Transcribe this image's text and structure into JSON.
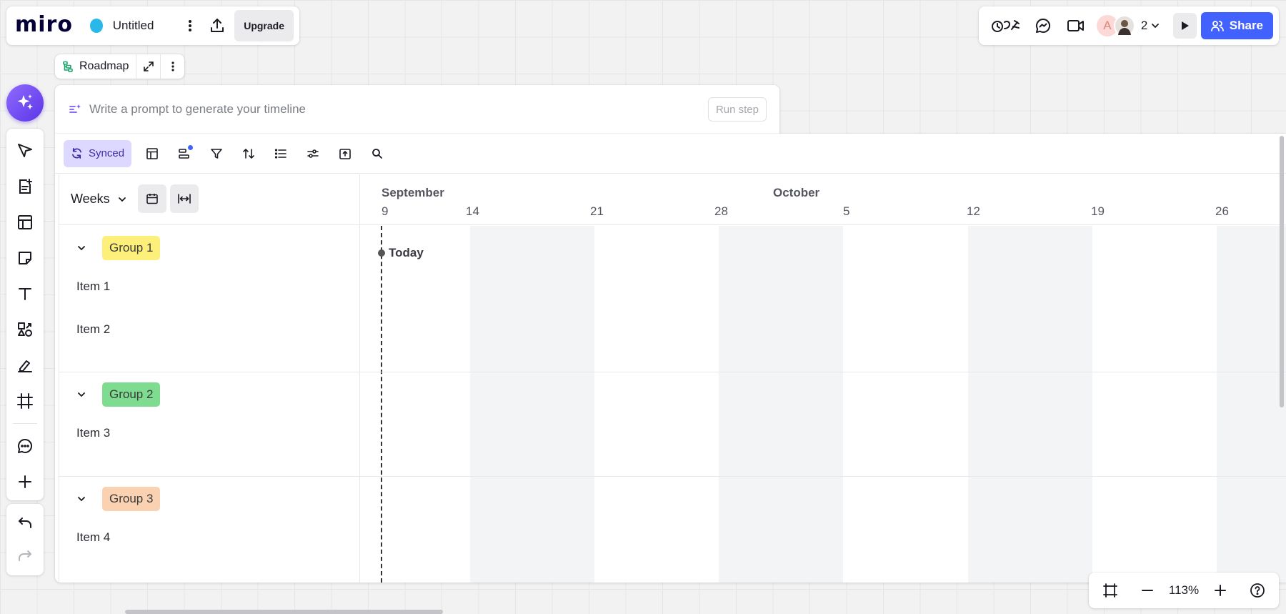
{
  "app": {
    "logo": "miro",
    "board_title": "Untitled",
    "upgrade_label": "Upgrade"
  },
  "topright": {
    "participant_initial": "A",
    "participant_count": "2",
    "share_label": "Share"
  },
  "roadmap": {
    "label": "Roadmap"
  },
  "prompt": {
    "placeholder": "Write a prompt to generate your timeline",
    "run_label": "Run step"
  },
  "timeline_toolbar": {
    "synced_label": "Synced"
  },
  "timeline": {
    "scale_label": "Weeks",
    "months": [
      "September",
      "October"
    ],
    "days": [
      "9",
      "14",
      "21",
      "28",
      "5",
      "12",
      "19",
      "26"
    ],
    "today_label": "Today",
    "groups": [
      {
        "label": "Group 1",
        "color": "#fdf07a",
        "items": [
          "Item 1",
          "Item 2"
        ]
      },
      {
        "label": "Group 2",
        "color": "#7ddc8f",
        "items": [
          "Item 3"
        ]
      },
      {
        "label": "Group 3",
        "color": "#fbd2b1",
        "items": [
          "Item 4"
        ]
      }
    ]
  },
  "zoom": {
    "level": "113%"
  },
  "colors": {
    "accent": "#4262ff",
    "synced_bg": "#ddd8ff",
    "ai_purple": "#6b45f0"
  }
}
